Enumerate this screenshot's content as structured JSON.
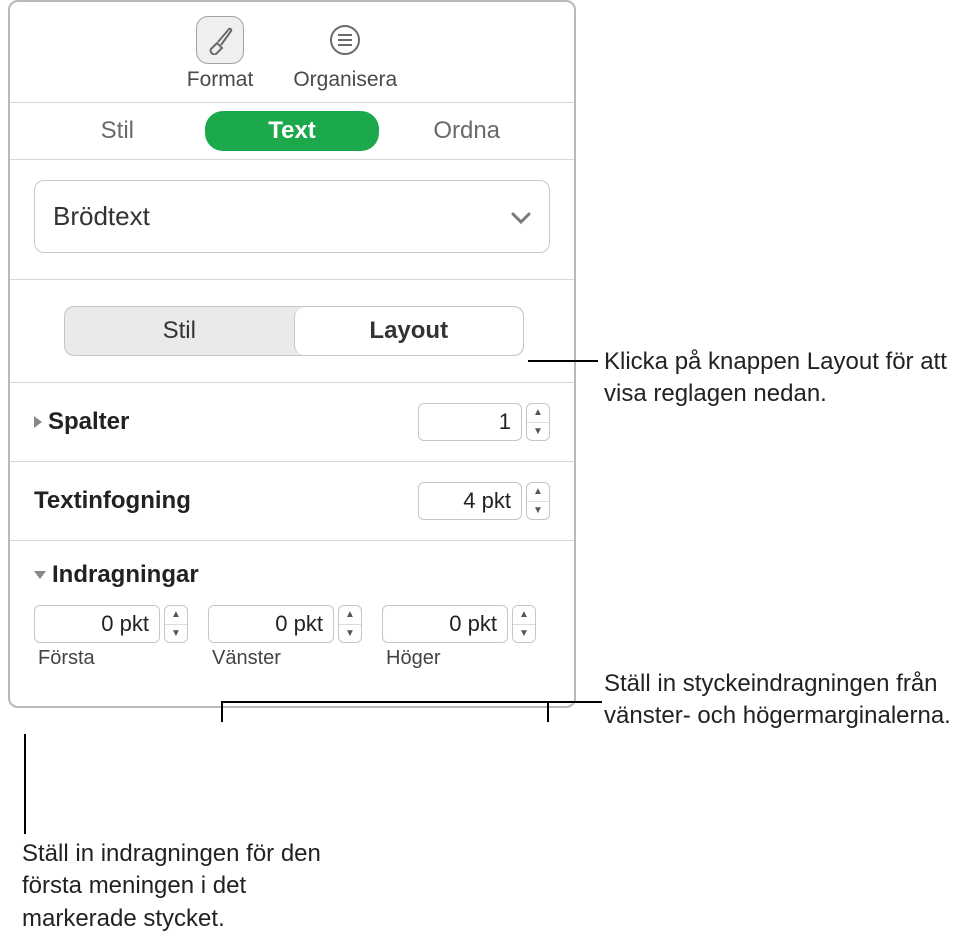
{
  "toolbar": {
    "format_label": "Format",
    "organize_label": "Organisera"
  },
  "tabs": {
    "style": "Stil",
    "text": "Text",
    "arrange": "Ordna"
  },
  "style_select": {
    "value": "Brödtext"
  },
  "segment": {
    "style": "Stil",
    "layout": "Layout"
  },
  "columns": {
    "label": "Spalter",
    "value": "1"
  },
  "inset": {
    "label": "Textinfogning",
    "value": "4 pkt"
  },
  "indents": {
    "label": "Indragningar",
    "first": {
      "value": "0 pkt",
      "label": "Första"
    },
    "left": {
      "value": "0 pkt",
      "label": "Vänster"
    },
    "right": {
      "value": "0 pkt",
      "label": "Höger"
    }
  },
  "callouts": {
    "layout": "Klicka på knappen Layout för att visa reglagen nedan.",
    "margins": "Ställ in styckeindragningen från vänster- och högermarginalerna.",
    "first": "Ställ in indragningen för den första meningen i det markerade stycket."
  }
}
